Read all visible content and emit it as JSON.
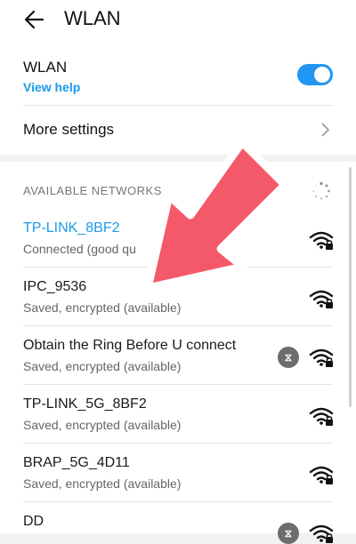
{
  "header": {
    "title": "WLAN"
  },
  "wlan": {
    "label": "WLAN",
    "help_link": "View help",
    "enabled": true,
    "accent_color": "#2196f3"
  },
  "more_settings": {
    "label": "More settings"
  },
  "available": {
    "heading": "AVAILABLE NETWORKS"
  },
  "networks": [
    {
      "name": "TP-LINK_8BF2",
      "status": "Connected (good qu",
      "connected": true,
      "locked": true,
      "hotspot": false
    },
    {
      "name": "IPC_9536",
      "status": "Saved, encrypted (available)",
      "connected": false,
      "locked": true,
      "hotspot": false
    },
    {
      "name": "Obtain the Ring Before U connect",
      "status": "Saved, encrypted (available)",
      "connected": false,
      "locked": true,
      "hotspot": true
    },
    {
      "name": "TP-LINK_5G_8BF2",
      "status": "Saved, encrypted (available)",
      "connected": false,
      "locked": true,
      "hotspot": false
    },
    {
      "name": "BRAP_5G_4D11",
      "status": "Saved, encrypted (available)",
      "connected": false,
      "locked": true,
      "hotspot": false
    },
    {
      "name": "DD",
      "status": "",
      "connected": false,
      "locked": true,
      "hotspot": true
    }
  ],
  "icons": {
    "back": "back-arrow-icon",
    "chevron": "chevron-right-icon",
    "spinner": "loading-spinner-icon",
    "wifi": "wifi-signal-locked-icon",
    "hotspot": "hotspot-icon",
    "overlay_arrow": "red-pointer-arrow"
  },
  "overlay": {
    "arrow_color": "#f4596a"
  }
}
